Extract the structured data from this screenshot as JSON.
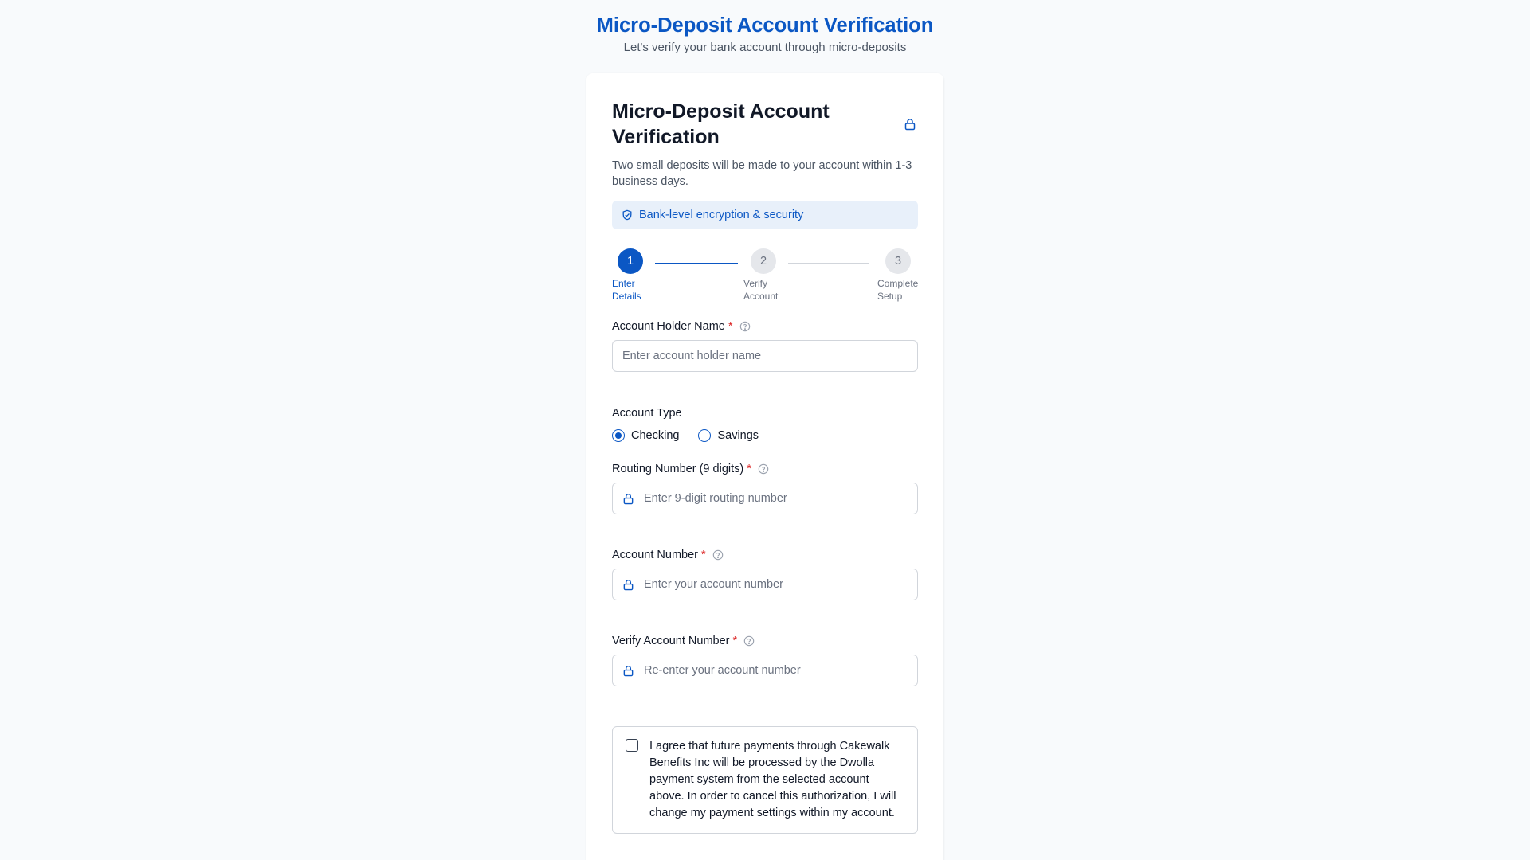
{
  "header": {
    "title": "Micro-Deposit Account Verification",
    "subtitle": "Let's verify your bank account through micro-deposits"
  },
  "card": {
    "title": "Micro-Deposit Account Verification",
    "description": "Two small deposits will be made to your account within 1-3 business days.",
    "security_text": "Bank-level encryption & security"
  },
  "stepper": {
    "steps": [
      {
        "number": "1",
        "label": "Enter Details",
        "state": "active"
      },
      {
        "number": "2",
        "label": "Verify Account",
        "state": "inactive"
      },
      {
        "number": "3",
        "label": "Complete Setup",
        "state": "inactive"
      }
    ]
  },
  "form": {
    "holder_name": {
      "label": "Account Holder Name",
      "required": "*",
      "placeholder": "Enter account holder name",
      "value": ""
    },
    "account_type": {
      "label": "Account Type",
      "options": [
        "Checking",
        "Savings"
      ],
      "selected": "Checking"
    },
    "routing": {
      "label": "Routing Number (9 digits)",
      "required": "*",
      "placeholder": "Enter 9-digit routing number",
      "value": ""
    },
    "account_number": {
      "label": "Account Number",
      "required": "*",
      "placeholder": "Enter your account number",
      "value": ""
    },
    "verify_account": {
      "label": "Verify Account Number",
      "required": "*",
      "placeholder": "Re-enter your account number",
      "value": ""
    },
    "agreement": "I agree that future payments through Cakewalk Benefits Inc will be processed by the Dwolla payment system from the selected account above. In order to cancel this authorization, I will change my payment settings within my account."
  },
  "colors": {
    "accent": "#0b57c4",
    "required": "#dc2626",
    "banner_bg": "#e8f0fa",
    "page_bg": "#f8fafc"
  },
  "icons": {
    "header_lock": "lock-icon",
    "banner": "shield-check-icon",
    "help": "help-circle-icon",
    "input_lock": "lock-icon"
  }
}
